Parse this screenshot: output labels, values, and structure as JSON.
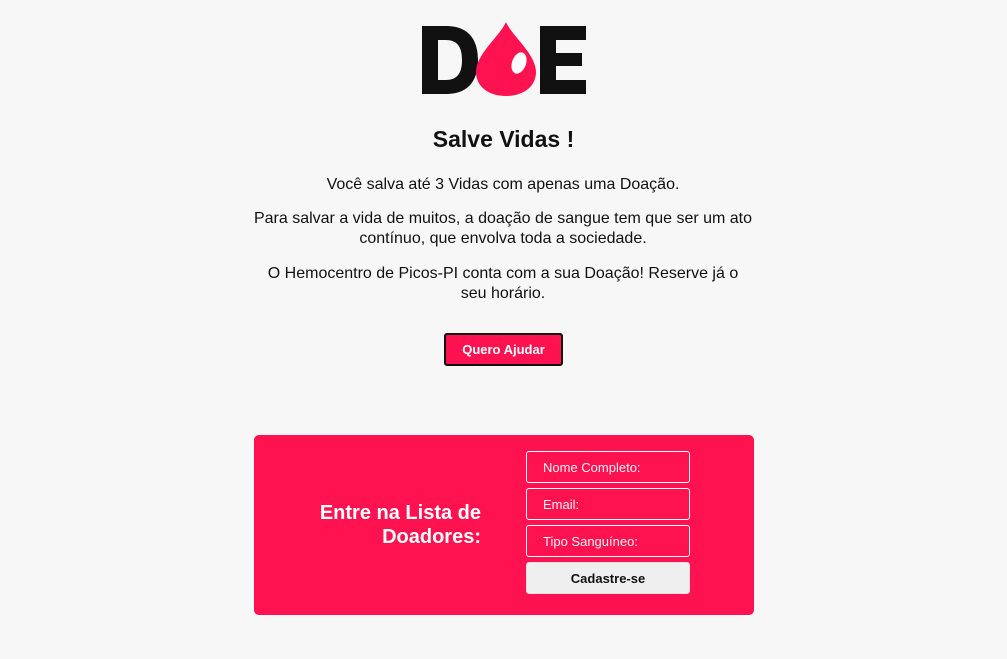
{
  "header": {
    "logo_text": "DOE"
  },
  "hero": {
    "title": "Salve Vidas !",
    "paragraph_1": "Você salva até 3 Vidas com apenas uma Doação.",
    "paragraph_2": "Para salvar a vida de muitos, a doação de sangue tem que ser um ato contínuo, que envolva toda a sociedade.",
    "paragraph_3": "O Hemocentro de Picos-PI conta com a sua Doação! Reserve já o seu horário.",
    "cta_label": "Quero Ajudar"
  },
  "signup": {
    "heading": "Entre na Lista de Doadores:",
    "name_placeholder": "Nome Completo:",
    "email_placeholder": "Email:",
    "blood_type_placeholder": "Tipo Sanguíneo:",
    "submit_label": "Cadastre-se"
  },
  "colors": {
    "brand": "#ff124f",
    "background": "#f7f7f7",
    "text": "#111111"
  },
  "icons": {
    "logo_drop": "blood-drop-icon"
  }
}
